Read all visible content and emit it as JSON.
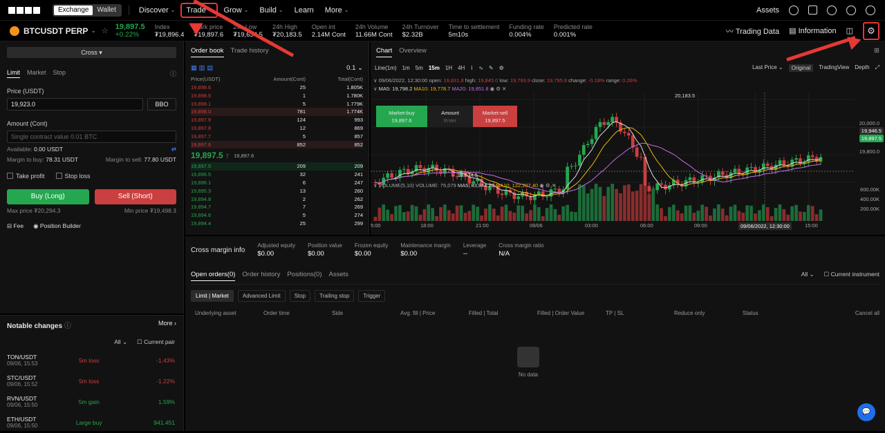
{
  "nav": {
    "seg_exchange": "Exchange",
    "seg_wallet": "Wallet",
    "items": [
      {
        "label": "Discover",
        "chev": true
      },
      {
        "label": "Trade",
        "chev": true
      },
      {
        "label": "Grow",
        "chev": true
      },
      {
        "label": "Build",
        "chev": true
      },
      {
        "label": "Learn",
        "chev": false
      },
      {
        "label": "More",
        "chev": true
      }
    ],
    "assets": "Assets"
  },
  "ticker": {
    "pair": "BTCUSDT PERP",
    "last": "19,897.5",
    "change": "+0.22%",
    "stats": [
      {
        "k": "Index",
        "v": "₮19,896.4"
      },
      {
        "k": "Mark price",
        "v": "₮19,897.6"
      },
      {
        "k": "24h Low",
        "v": "₮19,634.5"
      },
      {
        "k": "24h High",
        "v": "₮20,183.5"
      },
      {
        "k": "Open int",
        "v": "2.14M Cont"
      },
      {
        "k": "24h Volume",
        "v": "11.66M Cont"
      },
      {
        "k": "24h Turnover",
        "v": "$2.32B"
      },
      {
        "k": "Time to settlement",
        "v": "5m10s"
      },
      {
        "k": "Funding rate",
        "v": "0.004%"
      },
      {
        "k": "Predicted rate",
        "v": "0.001%"
      }
    ],
    "trading_data": "Trading Data",
    "information": "Information"
  },
  "form": {
    "margin_mode": "Cross",
    "tabs": [
      "Limit",
      "Market",
      "Stop"
    ],
    "price_label": "Price (USDT)",
    "price_value": "19,923.0",
    "bbo": "BBO",
    "amount_label": "Amount (Cont)",
    "amount_placeholder": "Single contract value 0.01 BTC",
    "available_label": "Available:",
    "available_value": "0.00 USDT",
    "margin_buy_label": "Margin to buy:",
    "margin_buy_value": "78.31 USDT",
    "margin_sell_label": "Margin to sell:",
    "margin_sell_value": "77.80 USDT",
    "take_profit": "Take profit",
    "stop_loss": "Stop loss",
    "buy": "Buy (Long)",
    "sell": "Sell (Short)",
    "max_price": "Max price ₮20,294.3",
    "min_price": "Min price ₮19,498.3",
    "fee": "Fee",
    "position_builder": "Position Builder"
  },
  "notable": {
    "title": "Notable changes",
    "more": "More",
    "filter_all": "All",
    "current_pair": "Current pair",
    "rows": [
      {
        "pair": "TON/USDT",
        "time": "09/06, 15:53",
        "event": "5m loss",
        "pct": "-1.43%",
        "dir": "down"
      },
      {
        "pair": "STC/USDT",
        "time": "09/06, 15:52",
        "event": "5m loss",
        "pct": "-1.22%",
        "dir": "down"
      },
      {
        "pair": "RVN/USDT",
        "time": "09/06, 15:50",
        "event": "5m gain",
        "pct": "1.59%",
        "dir": "up"
      },
      {
        "pair": "ETH/USDT",
        "time": "09/06, 15:50",
        "event": "Large buy",
        "pct": "941.451",
        "dir": "up"
      }
    ]
  },
  "orderbook": {
    "tabs": [
      "Order book",
      "Trade history"
    ],
    "tick": "0.1",
    "headers": [
      "Price(USDT)",
      "Amount(Cont)",
      "Total(Cont)"
    ],
    "asks": [
      [
        "19,898.6",
        "25",
        "1.805K"
      ],
      [
        "19,898.5",
        "1",
        "1.780K"
      ],
      [
        "19,898.1",
        "5",
        "1.779K"
      ],
      [
        "19,898.0",
        "781",
        "1.774K"
      ],
      [
        "19,897.9",
        "124",
        "993"
      ],
      [
        "19,897.8",
        "12",
        "869"
      ],
      [
        "19,897.7",
        "5",
        "857"
      ],
      [
        "19,897.6",
        "852",
        "852"
      ]
    ],
    "mid": "19,897.5",
    "mid_mark": "19,897.6",
    "bids": [
      [
        "19,897.5",
        "209",
        "209"
      ],
      [
        "19,896.5",
        "32",
        "241"
      ],
      [
        "19,896.1",
        "6",
        "247"
      ],
      [
        "19,895.3",
        "13",
        "260"
      ],
      [
        "19,894.8",
        "2",
        "262"
      ],
      [
        "19,894.7",
        "7",
        "269"
      ],
      [
        "19,894.6",
        "5",
        "274"
      ],
      [
        "19,894.4",
        "25",
        "299"
      ]
    ]
  },
  "chart": {
    "tabs": [
      "Chart",
      "Overview"
    ],
    "intervals": [
      "Line(1m)",
      "1m",
      "5m",
      "15m",
      "1H",
      "4H"
    ],
    "active_interval": "15m",
    "last_price": "Last Price",
    "views": [
      "Original",
      "TradingView",
      "Depth"
    ],
    "ohlc_line": {
      "time": "09/06/2022, 12:30:00",
      "open_k": "open:",
      "open": "19,831.8",
      "high_k": "high:",
      "high": "19,845.0",
      "low_k": "low:",
      "low": "19,793.9",
      "close_k": "close:",
      "close": "19,795.8",
      "change_k": "change:",
      "change": "-0.18%",
      "range_k": "range:",
      "range": "0.26%"
    },
    "ma_line": {
      "ma5": "MA5: 19,798.2",
      "ma10": "MA10: 19,778.7",
      "ma20": "MA20: 19,851.8"
    },
    "quick_buy": "Market-buy",
    "quick_buy_price": "19,897.6",
    "quick_amount": "Amount",
    "quick_amount_ph": "Enter",
    "quick_sell": "Market-sell",
    "quick_sell_price": "19,897.5",
    "vol_line": {
      "vol": "VOLUME(5,10)",
      "v": "VOLUME: 75,079",
      "ma5": "MA5: 83,844.20",
      "ma10": "MA10: 122,207.40"
    },
    "y_labels": [
      "20,000.0",
      "19,800.0"
    ],
    "vol_labels": [
      "600.00K",
      "400.00K",
      "200.00K"
    ],
    "hi_label": "20,183.5",
    "lo_label": "← 19,634.5",
    "tag_cross": "19,946.5",
    "tag_last": "19,897.5",
    "x_labels": [
      "5:00",
      "18:00",
      "21:00",
      "09/06",
      "03:00",
      "06:00",
      "09:00",
      "12:00",
      "15:00"
    ],
    "x_crosshair": "09/06/2022, 12:30:00"
  },
  "account": {
    "title": "Cross margin info",
    "fields": [
      {
        "k": "Adjusted equity",
        "v": "$0.00"
      },
      {
        "k": "Position value",
        "v": "$0.00"
      },
      {
        "k": "Frozen equity",
        "v": "$0.00"
      },
      {
        "k": "Maintenance margin",
        "v": "$0.00"
      },
      {
        "k": "Leverage",
        "v": "--"
      },
      {
        "k": "Cross margin ratio",
        "v": "N/A"
      }
    ],
    "tabs": [
      "Open orders(0)",
      "Order history",
      "Positions(0)",
      "Assets"
    ],
    "filter_all": "All",
    "current_instrument": "Current instrument",
    "pills": [
      "Limit | Market",
      "Advanced Limit",
      "Stop",
      "Trailing stop",
      "Trigger"
    ],
    "columns": [
      "Underlying asset",
      "Order time",
      "Side",
      "Avg. fill | Price",
      "Filled | Total",
      "Filled | Order Value",
      "TP | SL",
      "Reduce only",
      "Status",
      "Cancel all"
    ],
    "no_data": "No data"
  }
}
